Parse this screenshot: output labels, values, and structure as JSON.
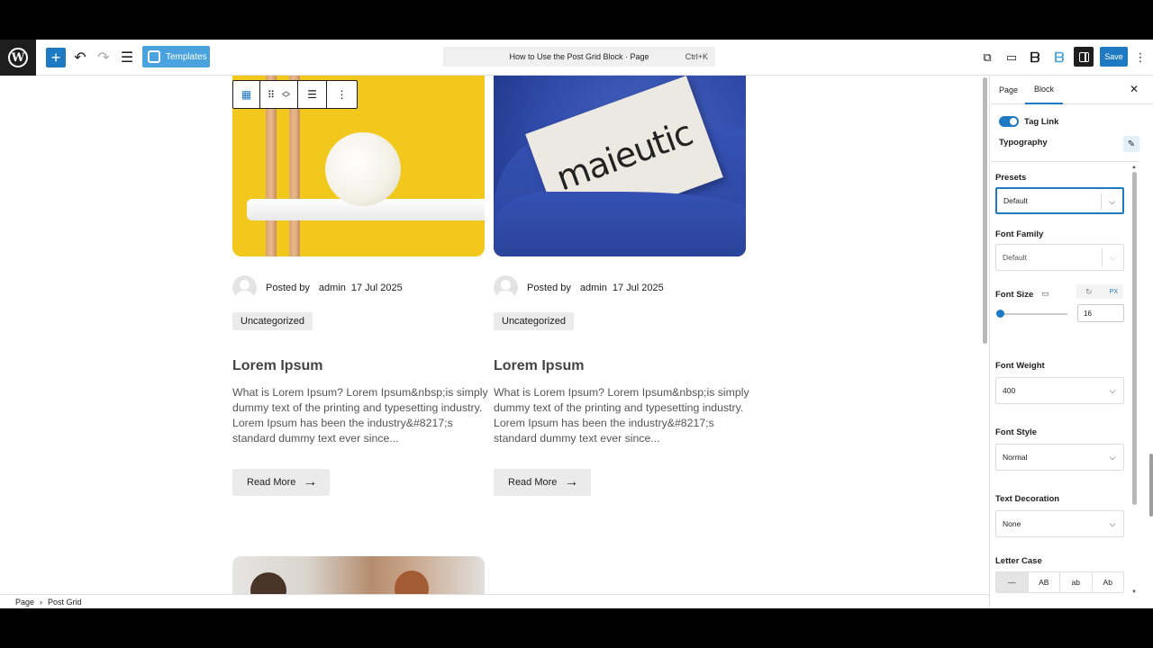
{
  "topbar": {
    "document_title": "How to Use the Post Grid Block · Page",
    "shortcut": "Ctrl+K",
    "templates_label": "Templates",
    "save_label": "Save",
    "add_icon": "plus-icon",
    "undo_icon": "undo-icon",
    "redo_icon": "redo-icon",
    "list_view_icon": "list-view-icon",
    "view_icon": "external-link-icon",
    "device_icon": "desktop-icon",
    "more_icon": "kebab-icon"
  },
  "posts": [
    {
      "image": "yellow-lamp",
      "posted_by": "Posted by",
      "author": "admin",
      "date": "17 Jul 2025",
      "category": "Uncategorized",
      "title": "Lorem Ipsum",
      "excerpt": "What is Lorem Ipsum? Lorem Ipsum&nbsp;is simply dummy text of the printing and typesetting industry. Lorem Ipsum has been the industry&#8217;s standard dummy text ever since...",
      "read_more": "Read More"
    },
    {
      "image": "blue-card",
      "image_text": "maieutic",
      "posted_by": "Posted by",
      "author": "admin",
      "date": "17 Jul 2025",
      "category": "Uncategorized",
      "title": "Lorem Ipsum",
      "excerpt": "What is Lorem Ipsum? Lorem Ipsum&nbsp;is simply dummy text of the printing and typesetting industry. Lorem Ipsum has been the industry&#8217;s standard dummy text ever since...",
      "read_more": "Read More"
    }
  ],
  "breadcrumb": {
    "items": [
      "Page",
      "Post Grid"
    ],
    "separator": "›"
  },
  "sidebar": {
    "tabs": [
      "Page",
      "Block"
    ],
    "active_tab": "Block",
    "tag_link_label": "Tag Link",
    "tag_link_enabled": true,
    "typography_label": "Typography",
    "presets": {
      "label": "Presets",
      "value": "Default"
    },
    "font_family": {
      "label": "Font Family",
      "value": "Default"
    },
    "font_size": {
      "label": "Font Size",
      "value": "16",
      "unit": "PX"
    },
    "font_weight": {
      "label": "Font Weight",
      "value": "400"
    },
    "font_style": {
      "label": "Font Style",
      "value": "Normal"
    },
    "text_decoration": {
      "label": "Text Decoration",
      "value": "None"
    },
    "letter_case": {
      "label": "Letter Case",
      "options": [
        "—",
        "AB",
        "ab",
        "Ab"
      ],
      "selected": "—"
    }
  },
  "colors": {
    "accent": "#1f7ac4",
    "templates_button": "#4aa3df",
    "dark": "#1e1e1e"
  }
}
